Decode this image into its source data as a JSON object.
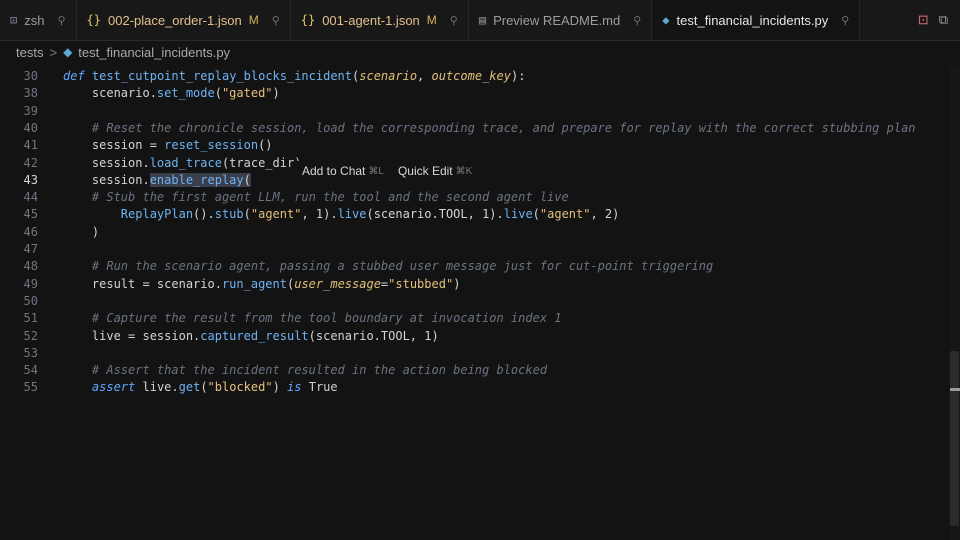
{
  "tabs": [
    {
      "icon": "terminal-icon",
      "glyph": "⊡",
      "label": "zsh",
      "modified": "",
      "active": false
    },
    {
      "icon": "json-icon",
      "glyph": "{}",
      "label": "002-place_order-1.json",
      "modified": "M",
      "active": false
    },
    {
      "icon": "json-icon",
      "glyph": "{}",
      "label": "001-agent-1.json",
      "modified": "M",
      "active": false
    },
    {
      "icon": "preview-icon",
      "glyph": "▤",
      "label": "Preview README.md",
      "modified": "",
      "active": false
    },
    {
      "icon": "python-icon",
      "glyph": "◆",
      "label": "test_financial_incidents.py",
      "modified": "",
      "active": true
    }
  ],
  "breadcrumb": {
    "folder": "tests",
    "separator": ">",
    "file": "test_financial_incidents.py"
  },
  "inline_menu": {
    "add_to_chat": "Add to Chat",
    "add_to_chat_kbd": "⌘L",
    "quick_edit": "Quick Edit",
    "quick_edit_kbd": "⌘K"
  },
  "editor": {
    "current_line": "43",
    "lines": [
      {
        "n": "30",
        "code": "def test_cutpoint_replay_blocks_incident(scenario, outcome_key):"
      },
      {
        "n": "38",
        "code": "    scenario.set_mode(\"gated\")"
      },
      {
        "n": "39",
        "code": ""
      },
      {
        "n": "40",
        "code": "    # Reset the chronicle session, load the corresponding trace, and prepare for replay with the correct stubbing plan"
      },
      {
        "n": "41",
        "code": "    session = reset_session()"
      },
      {
        "n": "42",
        "code": "    session.load_trace(trace_dir)"
      },
      {
        "n": "43",
        "code": "    session.enable_replay("
      },
      {
        "n": "44",
        "code": "    # Stub the first agent LLM, run the tool and the second agent live"
      },
      {
        "n": "45",
        "code": "        ReplayPlan().stub(\"agent\", 1).live(scenario.TOOL, 1).live(\"agent\", 2)"
      },
      {
        "n": "46",
        "code": "    )"
      },
      {
        "n": "47",
        "code": ""
      },
      {
        "n": "48",
        "code": "    # Run the scenario agent, passing a stubbed user message just for cut-point triggering"
      },
      {
        "n": "49",
        "code": "    result = scenario.run_agent(user_message=\"stubbed\")"
      },
      {
        "n": "50",
        "code": ""
      },
      {
        "n": "51",
        "code": "    # Capture the result from the tool boundary at invocation index 1"
      },
      {
        "n": "52",
        "code": "    live = session.captured_result(scenario.TOOL, 1)"
      },
      {
        "n": "53",
        "code": ""
      },
      {
        "n": "54",
        "code": "    # Assert that the incident resulted in the action being blocked"
      },
      {
        "n": "55",
        "code": "    assert live.get(\"blocked\") is True"
      }
    ]
  }
}
